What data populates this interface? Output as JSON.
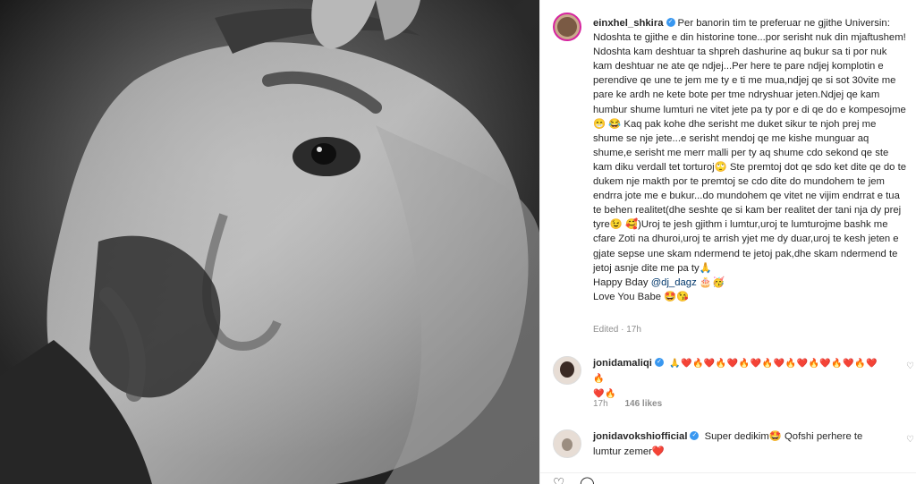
{
  "post": {
    "author": "einxhel_shkira",
    "caption": "Per banorin tim te preferuar ne gjithe Universin: Ndoshta te gjithe e din historine tone...por serisht nuk din mjaftushem! Ndoshta kam deshtuar ta shpreh dashurine aq bukur sa ti por nuk kam deshtuar ne ate qe ndjej...Per here te pare ndjej komplotin e perendive qe une te jem me ty e ti me mua,ndjej qe si sot 30vite me pare ke ardh ne kete bote per tme ndryshuar jeten.Ndjej qe kam humbur shume lumturi ne vitet jete pa ty por e di qe do e kompesojme😁 😂 Kaq pak kohe dhe serisht me duket sikur te njoh prej me shume se nje jete...e serisht mendoj qe me kishe munguar aq shume,e serisht me merr malli per ty aq shume cdo sekond qe ste kam diku verdall tet torturoj🙄 Ste premtoj dot qe sdo ket dite qe do te dukem nje makth por te premtoj se cdo dite do mundohem te jem endrra jote me e bukur...do mundohem qe vitet ne vijim endrrat e tua te behen realitet(dhe seshte qe si kam ber realitet der tani nja dy prej tyre😉 🥰)Uroj te jesh gjithm i lumtur,uroj te lumturojme bashk me cfare Zoti na dhuroi,uroj te arrish yjet me dy duar,uroj te kesh jeten e gjate sepse une skam ndermend te jetoj pak,dhe skam ndermend te jetoj asnje dite me pa ty🙏",
    "closing_line1_prefix": "Happy Bday ",
    "mention": "@dj_dagz",
    "closing_line1_suffix": " 🎂🥳",
    "closing_line2": "Love You Babe 🤩😘",
    "edited": "Edited · 17h"
  },
  "comments": [
    {
      "username": "jonidamaliqi",
      "text": "🙏❤️🔥❤️🔥❤️🔥❤️🔥❤️🔥❤️🔥❤️🔥❤️🔥❤️🔥",
      "text_line2": "❤️🔥",
      "time": "17h",
      "likes": "146 likes"
    },
    {
      "username": "jonidavokshiofficial",
      "text": "Super dedikim🤩 Qofshi perhere te lumtur zemer❤️"
    }
  ],
  "icons": {
    "verified": "verified-badge-icon",
    "like": "heart-outline-icon"
  },
  "colors": {
    "verified": "#3897f0",
    "mention": "#00376b",
    "muted": "#8e8e8e"
  }
}
